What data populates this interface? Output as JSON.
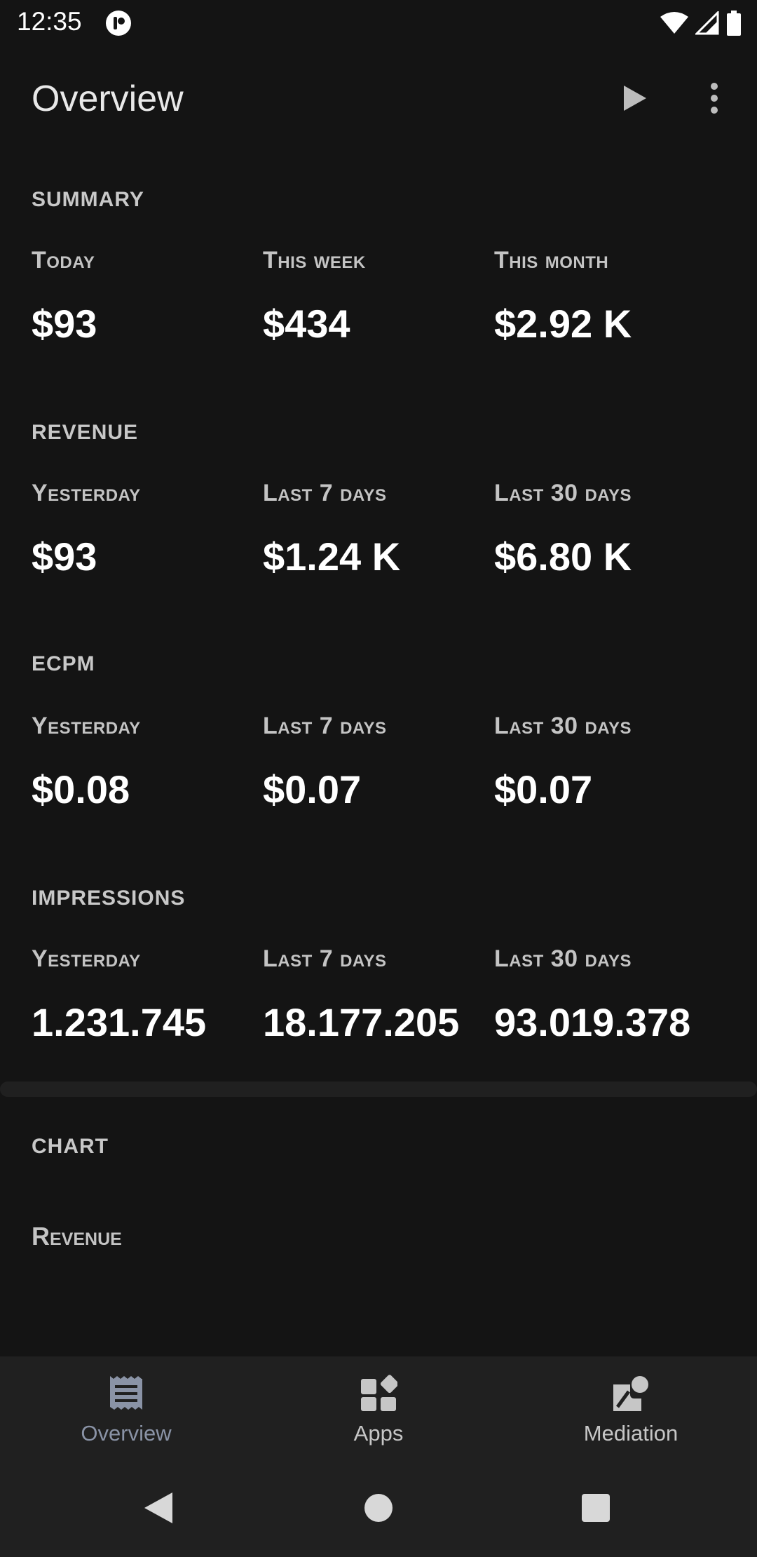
{
  "status_bar": {
    "time": "12:35"
  },
  "app_bar": {
    "title": "Overview"
  },
  "sections": [
    {
      "title": "SUMMARY",
      "metrics": [
        {
          "label": "Today",
          "value": "$93"
        },
        {
          "label": "This week",
          "value": "$434"
        },
        {
          "label": "This month",
          "value": "$2.92 K"
        }
      ]
    },
    {
      "title": "REVENUE",
      "metrics": [
        {
          "label": "Yesterday",
          "value": "$93"
        },
        {
          "label": "Last 7 days",
          "value": "$1.24 K"
        },
        {
          "label": "Last 30 days",
          "value": "$6.80 K"
        }
      ]
    },
    {
      "title": "ECPM",
      "metrics": [
        {
          "label": "Yesterday",
          "value": "$0.08"
        },
        {
          "label": "Last 7 days",
          "value": "$0.07"
        },
        {
          "label": "Last 30 days",
          "value": "$0.07"
        }
      ]
    },
    {
      "title": "IMPRESSIONS",
      "metrics": [
        {
          "label": "Yesterday",
          "value": "1.231.745"
        },
        {
          "label": "Last 7 days",
          "value": "18.177.205"
        },
        {
          "label": "Last 30 days",
          "value": "93.019.378"
        }
      ]
    }
  ],
  "chart": {
    "title": "CHART",
    "subtitle": "Revenue"
  },
  "bottom_nav": {
    "items": [
      {
        "label": "Overview",
        "icon": "receipt-icon",
        "active": true
      },
      {
        "label": "Apps",
        "icon": "apps-icon",
        "active": false
      },
      {
        "label": "Mediation",
        "icon": "mediation-icon",
        "active": false
      }
    ]
  },
  "colors": {
    "background": "#141414",
    "surface": "#202020",
    "active_nav": "#8a93a6",
    "text_primary": "#ffffff",
    "text_secondary": "#c4c4c4"
  }
}
